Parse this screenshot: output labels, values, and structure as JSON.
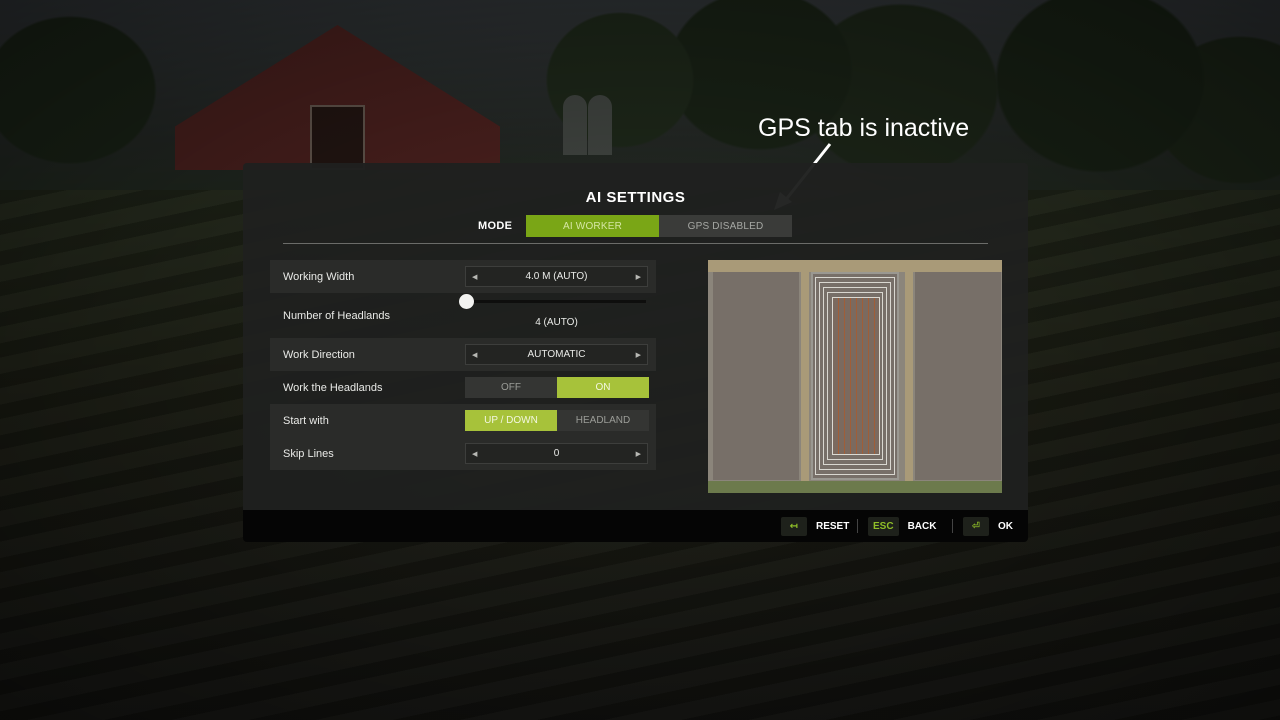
{
  "annotation": {
    "text": "GPS tab is inactive"
  },
  "dialog": {
    "title": "AI SETTINGS",
    "mode": {
      "label": "MODE",
      "tabs": [
        {
          "label": "AI WORKER",
          "state": "active"
        },
        {
          "label": "GPS DISABLED",
          "state": "inactive"
        }
      ]
    },
    "settings": {
      "working_width": {
        "label": "Working Width",
        "value": "4.0 M (AUTO)"
      },
      "headlands": {
        "label": "Number of Headlands",
        "value": "4 (AUTO)",
        "slider_fraction": 0
      },
      "work_direction": {
        "label": "Work Direction",
        "value": "AUTOMATIC"
      },
      "work_headlands": {
        "label": "Work the Headlands",
        "options": [
          "OFF",
          "ON"
        ],
        "selected": "ON"
      },
      "start_with": {
        "label": "Start with",
        "options": [
          "UP / DOWN",
          "HEADLAND"
        ],
        "selected": "UP / DOWN"
      },
      "skip_lines": {
        "label": "Skip Lines",
        "value": "0"
      }
    }
  },
  "footer": {
    "reset": {
      "key": "↤",
      "label": "RESET"
    },
    "back": {
      "key": "ESC",
      "label": "BACK"
    },
    "ok": {
      "key": "⏎",
      "label": "OK"
    }
  },
  "colors": {
    "accent_green": "#7aa616",
    "toggle_on": "#a7c23a",
    "panel_bg": "#1f201f"
  },
  "icons": {
    "step_left": "left-arrow-icon",
    "step_right": "right-arrow-icon",
    "reset_key": "reset-arrow-icon",
    "ok_key": "enter-key-icon"
  }
}
